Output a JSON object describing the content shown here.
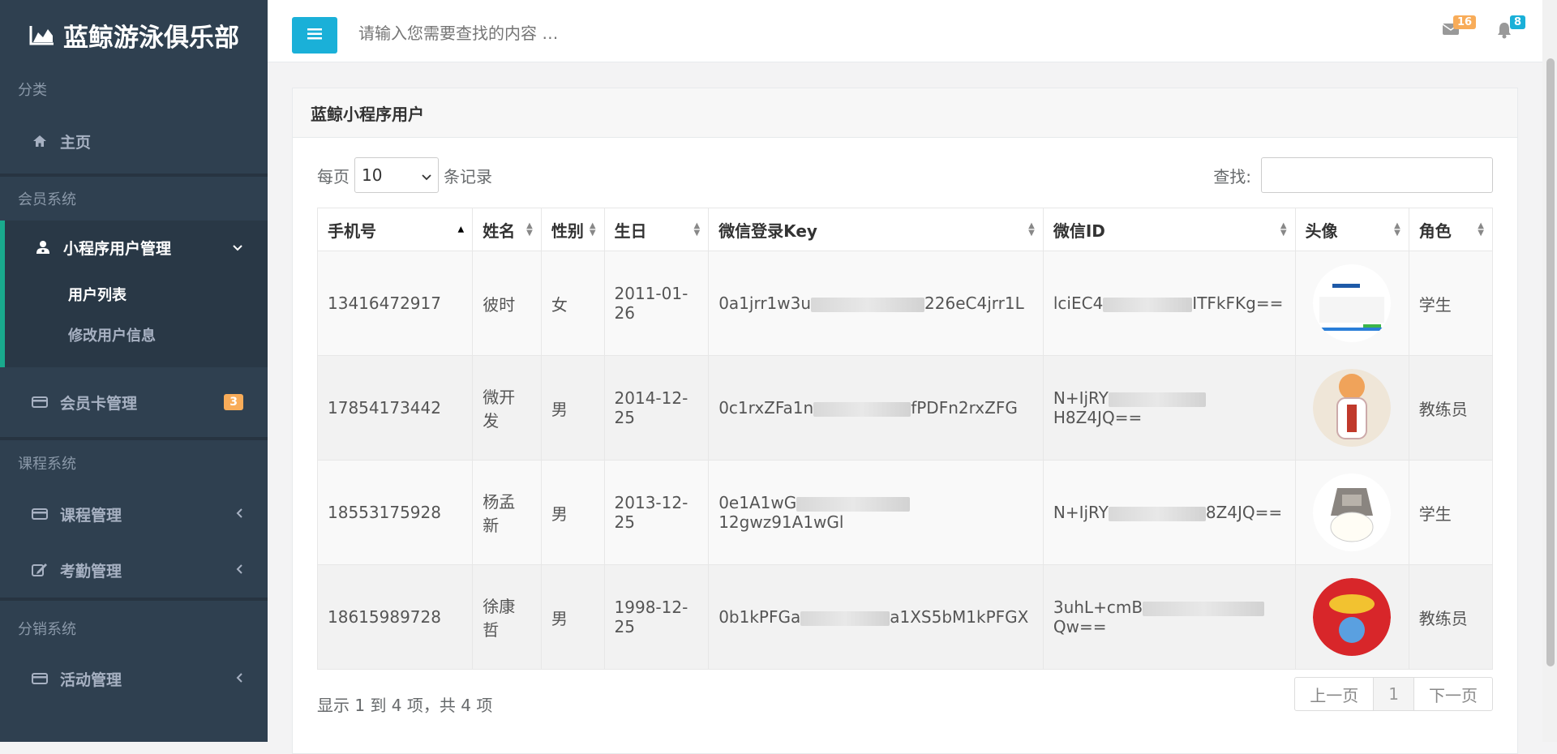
{
  "sidebar": {
    "brand": "蓝鲸游泳俱乐部",
    "section_category": "分类",
    "home": "主页",
    "section_member": "会员系统",
    "miniapp_user_mgmt": "小程序用户管理",
    "sub_user_list": "用户列表",
    "sub_edit_user": "修改用户信息",
    "member_card_mgmt": "会员卡管理",
    "member_card_badge": "3",
    "section_course": "课程系统",
    "course_mgmt": "课程管理",
    "attendance_mgmt": "考勤管理",
    "section_distribution": "分销系统",
    "activity_mgmt": "活动管理"
  },
  "topbar": {
    "search_placeholder": "请输入您需要查找的内容 …",
    "mail_count": "16",
    "bell_count": "8"
  },
  "panel": {
    "title": "蓝鲸小程序用户",
    "per_page_prefix": "每页",
    "per_page_value": "10",
    "per_page_suffix": "条记录",
    "search_label": "查找:",
    "columns": [
      "手机号",
      "姓名",
      "性别",
      "生日",
      "微信登录Key",
      "微信ID",
      "头像",
      "角色"
    ],
    "rows": [
      {
        "phone": "13416472917",
        "name": "彼时",
        "gender": "女",
        "birthday": "2011-01-26",
        "key_a": "0a1jrr1w3u",
        "key_b": "226eC4jrr1L",
        "wid_a": "lciEC4",
        "wid_b": "ITFkFKg==",
        "role": "学生"
      },
      {
        "phone": "17854173442",
        "name": "微开发",
        "gender": "男",
        "birthday": "2014-12-25",
        "key_a": "0c1rxZFa1n",
        "key_b": "fPDFn2rxZFG",
        "wid_a": "N+IjRY",
        "wid_b": "H8Z4JQ==",
        "role": "教练员"
      },
      {
        "phone": "18553175928",
        "name": "杨孟新",
        "gender": "男",
        "birthday": "2013-12-25",
        "key_a": "0e1A1wG",
        "key_b": "12gwz91A1wGl",
        "wid_a": "N+IjRY",
        "wid_b": "8Z4JQ==",
        "role": "学生"
      },
      {
        "phone": "18615989728",
        "name": "徐康哲",
        "gender": "男",
        "birthday": "1998-12-25",
        "key_a": "0b1kPFGa",
        "key_b": "a1XS5bM1kPFGX",
        "wid_a": "3uhL+cmB",
        "wid_b": "Qw==",
        "role": "教练员"
      }
    ],
    "info": "显示 1 到 4 项，共 4 项",
    "prev": "上一页",
    "page": "1",
    "next": "下一页"
  },
  "colors": {
    "sidebar_bg": "#2f4050",
    "accent": "#1ab0d8",
    "badge_orange": "#f8ac59",
    "active_border": "#19aa8d"
  }
}
